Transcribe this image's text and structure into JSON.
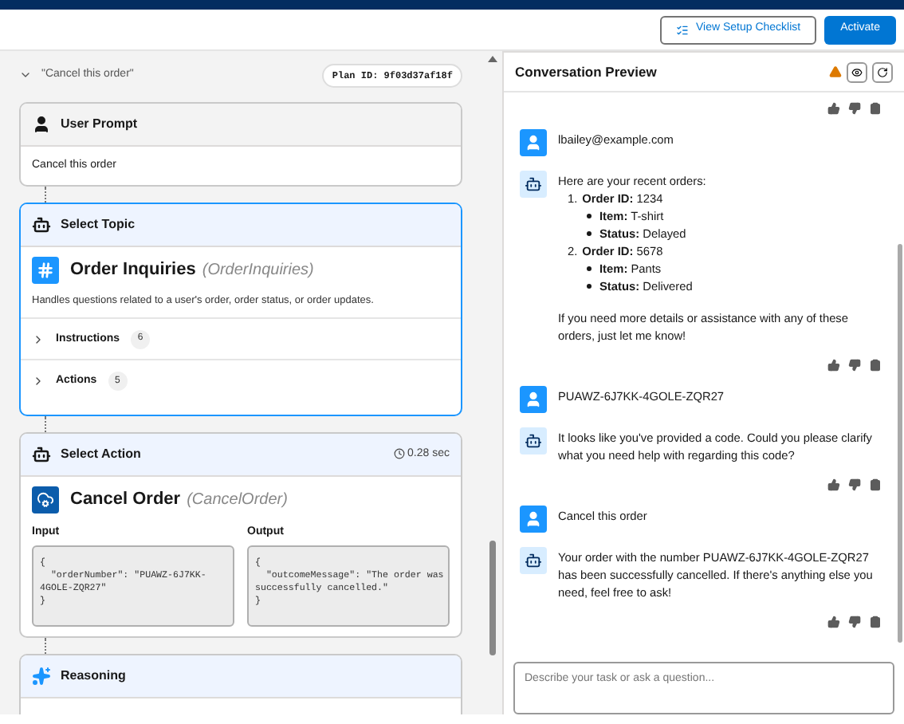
{
  "header": {
    "buttons": [
      {
        "label": "View Setup Checklist",
        "kind": "outline"
      },
      {
        "label": "Activate",
        "kind": "primary"
      }
    ]
  },
  "plan": {
    "prompt": "\"Cancel this order\"",
    "expanded": true,
    "plan_id": "Plan ID: 9f03d37af18f"
  },
  "steps": [
    {
      "kind": "prompt",
      "title": "User Prompt",
      "body": "Cancel this order"
    },
    {
      "kind": "topic",
      "title": "Select Topic",
      "name": "Order Inquiries",
      "api_name": "(OrderInquiries)",
      "description": "Handles questions related to a user's order, order status, or order updates.",
      "sections": [
        {
          "label": "Instructions",
          "count": "6",
          "expanded": false
        },
        {
          "label": "Actions",
          "count": "5",
          "expanded": false
        }
      ]
    },
    {
      "kind": "action",
      "title": "Select Action",
      "duration": "0.28 sec",
      "name": "Cancel Order",
      "api_name": "(CancelOrder)",
      "input_label": "Input",
      "input": "{\n  \"orderNumber\": \"PUAWZ-6J7KK-\n4GOLE-ZQR27\"\n}",
      "output_label": "Output",
      "output": "{\n  \"outcomeMessage\": \"The order was\nsuccessfully cancelled.\"\n}"
    },
    {
      "kind": "reasoning",
      "title": "Reasoning"
    }
  ],
  "preview": {
    "title": "Conversation Preview",
    "warning": true,
    "items": [
      {
        "kind": "feedback"
      },
      {
        "kind": "user",
        "text": "lbailey@example.com"
      },
      {
        "kind": "agent",
        "intro": "Here are your recent orders:",
        "orders": [
          {
            "marker": "1.",
            "line": "**Order ID:** 1234",
            "details": [
              "**Item:** T-shirt",
              "**Status:** Delayed"
            ]
          },
          {
            "marker": "2.",
            "line": "**Order ID:** 5678",
            "details": [
              "**Item:** Pants",
              "**Status:** Delivered"
            ]
          }
        ],
        "outro": "If you need more details or assistance with any of these orders, just let me know!"
      },
      {
        "kind": "feedback"
      },
      {
        "kind": "user",
        "text": "PUAWZ-6J7KK-4GOLE-ZQR27"
      },
      {
        "kind": "agent",
        "intro": "It looks like you've provided a code. Could you please clarify what you need help with regarding this code?"
      },
      {
        "kind": "feedback"
      },
      {
        "kind": "user",
        "text": "Cancel this order"
      },
      {
        "kind": "agent",
        "intro": "Your order with the number PUAWZ-6J7KK-4GOLE-ZQR27 has been successfully cancelled. If there's anything else you need, feel free to ask!"
      },
      {
        "kind": "feedback"
      }
    ],
    "input": {
      "placeholder": "Describe your task or ask a question..."
    }
  }
}
